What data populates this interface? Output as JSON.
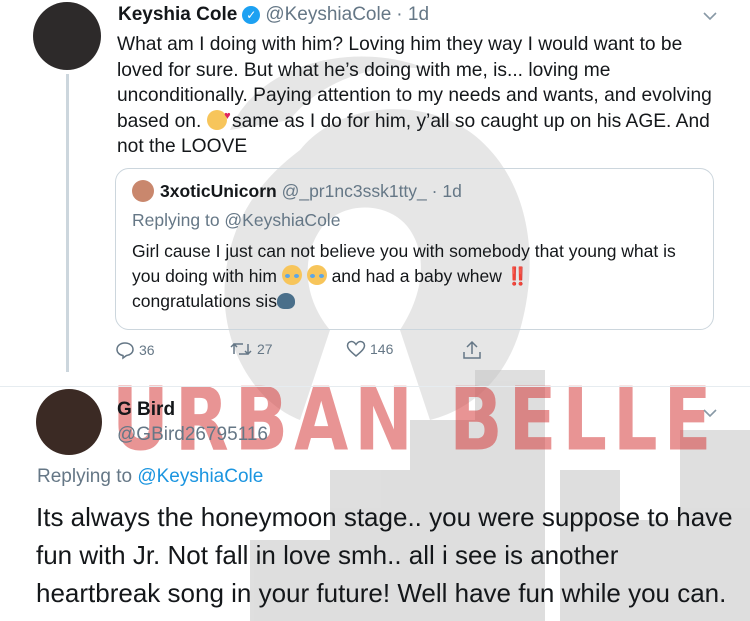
{
  "watermark": {
    "text": "URBAN BELLE",
    "color": "#d63c3c"
  },
  "tweet1": {
    "name": "Keyshia Cole",
    "handle": "@KeyshiaCole",
    "time": "· 1d",
    "verified_icon": "verified-badge-icon",
    "body_part1": "What am I doing with him? Loving him they way I would want to be loved for sure. But what he’s doing with me, is... loving me unconditionally. Paying attention to my needs and wants, and evolving based on.",
    "body_part2": " same as I do for him, y’all so caught up on his AGE. And not the LOOVE",
    "quote": {
      "name": "3xoticUnicorn",
      "handle": "@_pr1nc3ssk1tty_",
      "time": "· 1d",
      "replying_to": "Replying to @KeyshiaCole",
      "body_part1": "Girl cause I just can not believe you with somebody that young what is you doing with him",
      "body_part2": " and had a baby whew",
      "body_bang": "‼️",
      "body_part3": "congratulations sis"
    },
    "actions": {
      "replies": "36",
      "retweets": "27",
      "likes": "146"
    }
  },
  "tweet2": {
    "name": "G Bird",
    "handle": "@GBird26795116",
    "replying_prefix": "Replying to ",
    "replying_user": "@KeyshiaCole",
    "body": "Its always the honeymoon stage.. you were suppose to have fun with Jr. Not fall in love smh.. all i see is another heartbreak song in your future! Well have fun while you can."
  },
  "colors": {
    "link": "#1b95e0",
    "muted": "#657786",
    "verified": "#1da1f2"
  }
}
